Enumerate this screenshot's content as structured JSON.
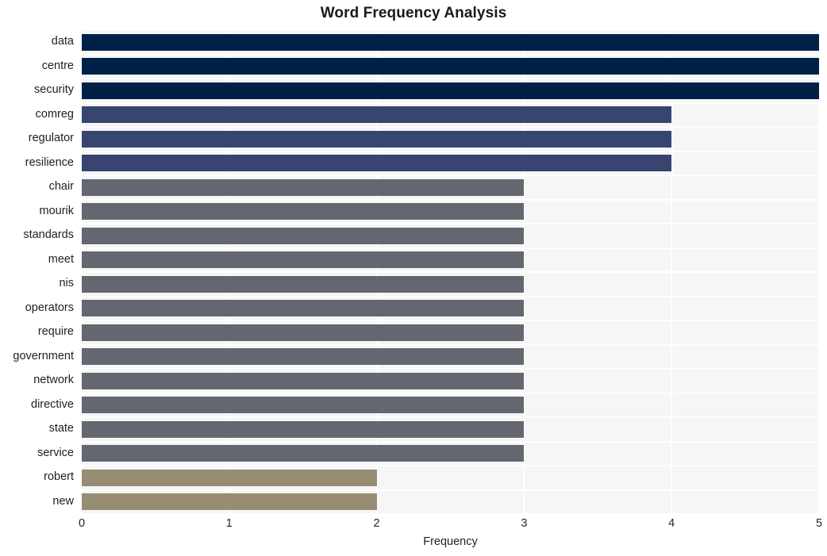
{
  "chart_data": {
    "type": "bar",
    "orientation": "horizontal",
    "title": "Word Frequency Analysis",
    "xlabel": "Frequency",
    "ylabel": "",
    "xlim": [
      0,
      5
    ],
    "xticks": [
      "0",
      "1",
      "2",
      "3",
      "4",
      "5"
    ],
    "grid": true,
    "grid_axis": "both",
    "legend": false,
    "categories": [
      "data",
      "centre",
      "security",
      "comreg",
      "regulator",
      "resilience",
      "chair",
      "mourik",
      "standards",
      "meet",
      "nis",
      "operators",
      "require",
      "government",
      "network",
      "directive",
      "state",
      "service",
      "robert",
      "new"
    ],
    "values": [
      5,
      5,
      5,
      4,
      4,
      4,
      3,
      3,
      3,
      3,
      3,
      3,
      3,
      3,
      3,
      3,
      3,
      3,
      2,
      2
    ],
    "bar_colors": [
      "#002147",
      "#002147",
      "#002147",
      "#374570",
      "#374570",
      "#374570",
      "#64676f",
      "#64676f",
      "#64676f",
      "#64676f",
      "#64676f",
      "#64676f",
      "#64676f",
      "#64676f",
      "#64676f",
      "#64676f",
      "#64676f",
      "#64676f",
      "#968d73",
      "#968d73"
    ],
    "palette": {
      "value_5": "#002147",
      "value_4": "#374570",
      "value_3": "#64676f",
      "value_2": "#968d73"
    },
    "plot_background": "#f6f6f7",
    "gridline_color": "#ffffff",
    "figure_background": "#ffffff"
  }
}
